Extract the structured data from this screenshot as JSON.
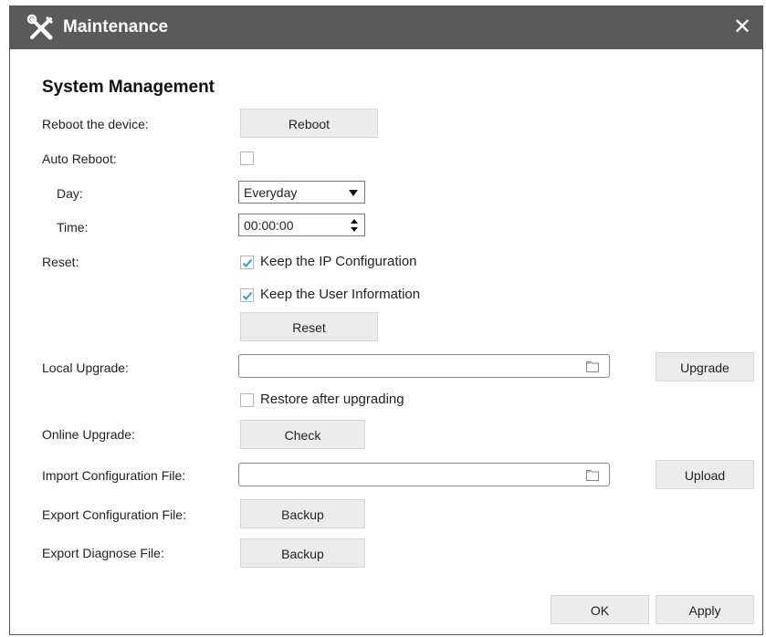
{
  "window": {
    "title": "Maintenance",
    "close_label": "✕"
  },
  "section_title": "System Management",
  "reboot": {
    "label": "Reboot the device:",
    "button": "Reboot"
  },
  "auto_reboot": {
    "label": "Auto Reboot:",
    "checked": false,
    "day_label": "Day:",
    "day_value": "Everyday",
    "time_label": "Time:",
    "time_value": "00:00:00"
  },
  "reset": {
    "label": "Reset:",
    "keep_ip_label": "Keep the IP Configuration",
    "keep_ip_checked": true,
    "keep_user_label": "Keep the User Information",
    "keep_user_checked": true,
    "button": "Reset"
  },
  "local_upgrade": {
    "label": "Local Upgrade:",
    "file_value": "",
    "button": "Upgrade",
    "restore_label": "Restore after upgrading",
    "restore_checked": false
  },
  "online_upgrade": {
    "label": "Online Upgrade:",
    "button": "Check"
  },
  "import_config": {
    "label": "Import Configuration File:",
    "file_value": "",
    "button": "Upload"
  },
  "export_config": {
    "label": "Export Configuration File:",
    "button": "Backup"
  },
  "export_diagnose": {
    "label": "Export Diagnose File:",
    "button": "Backup"
  },
  "footer": {
    "ok": "OK",
    "apply": "Apply"
  },
  "colors": {
    "titlebar": "#5a5a5a",
    "button_bg": "#ececec",
    "check": "#2f9de0"
  },
  "icons": {
    "title": "tools-icon",
    "close": "close-icon",
    "folder": "folder-icon",
    "checkmark": "checkmark-icon"
  }
}
